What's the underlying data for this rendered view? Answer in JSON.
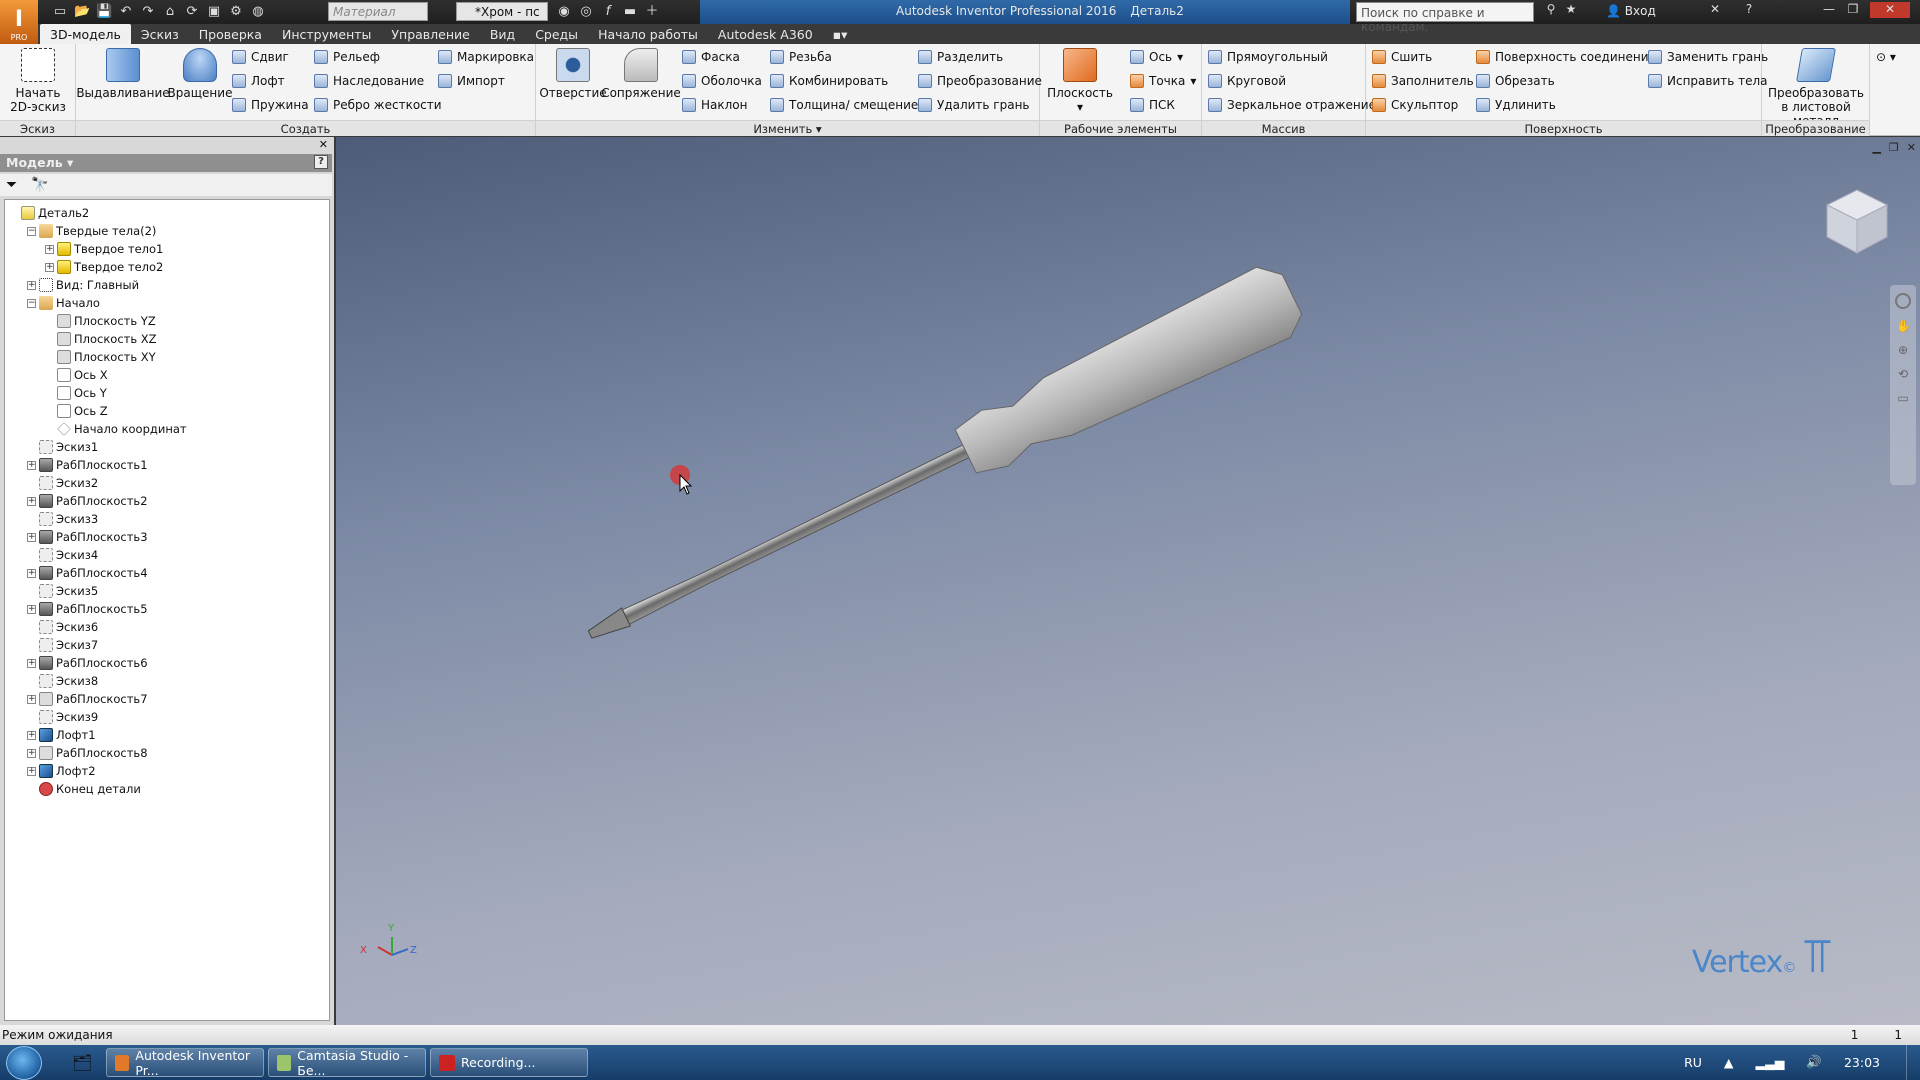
{
  "titlebar": {
    "app_badge": "PRO",
    "material_placeholder": "Материал",
    "appearance_value": "*Хром - пс",
    "window_title": "Autodesk Inventor Professional 2016",
    "document_name": "Деталь2",
    "search_placeholder": "Поиск по справке и командам.",
    "login_label": "Вход"
  },
  "tabs": [
    "3D-модель",
    "Эскиз",
    "Проверка",
    "Инструменты",
    "Управление",
    "Вид",
    "Среды",
    "Начало работы",
    "Autodesk A360"
  ],
  "active_tab": "3D-модель",
  "ribbon": {
    "sketch_panel": {
      "label": "Эскиз",
      "start_sketch": "Начать\n2D-эскиз"
    },
    "create_panel": {
      "label": "Создать",
      "extrude": "Выдавливание",
      "revolve": "Вращение",
      "sweep": "Сдвиг",
      "loft": "Лофт",
      "coil": "Пружина",
      "emboss": "Рельеф",
      "derive": "Наследование",
      "rib": "Ребро жесткости",
      "mark": "Маркировка",
      "import": "Импорт"
    },
    "modify_panel": {
      "label": "Изменить",
      "hole": "Отверстие",
      "fillet": "Сопряжение",
      "chamfer": "Фаска",
      "shell": "Оболочка",
      "draft": "Наклон",
      "thread": "Резьба",
      "combine": "Комбинировать",
      "thicken": "Толщина/ смещение",
      "split": "Разделить",
      "transform": "Преобразование",
      "delete_face": "Удалить грань"
    },
    "work_features_panel": {
      "label": "Рабочие элементы",
      "plane": "Плоскость",
      "axis": "Ось",
      "point": "Точка",
      "ucs": "ПСК"
    },
    "pattern_panel": {
      "label": "Массив",
      "rectangular": "Прямоугольный",
      "circular": "Круговой",
      "mirror": "Зеркальное отражение"
    },
    "surface_panel": {
      "label": "Поверхность",
      "stitch": "Сшить",
      "patch": "Заполнитель",
      "sculpt": "Скульптор",
      "boundary_patch": "Поверхность соединения",
      "trim": "Обрезать",
      "extend": "Удлинить",
      "replace_face": "Заменить грань",
      "repair_bodies": "Исправить тела"
    },
    "convert_panel": {
      "label": "Преобразование",
      "convert_sheet_metal": "Преобразовать в листовой металл"
    }
  },
  "browser": {
    "title": "Модель",
    "tree": [
      {
        "label": "Деталь2",
        "icon": "part",
        "level": 0,
        "expander": ""
      },
      {
        "label": "Твердые тела(2)",
        "icon": "folder",
        "level": 1,
        "expander": "−"
      },
      {
        "label": "Твердое тело1",
        "icon": "body",
        "level": 2,
        "expander": "+"
      },
      {
        "label": "Твердое тело2",
        "icon": "body",
        "level": 2,
        "expander": "+"
      },
      {
        "label": "Вид: Главный",
        "icon": "view",
        "level": 1,
        "expander": "+"
      },
      {
        "label": "Начало",
        "icon": "folder",
        "level": 1,
        "expander": "−"
      },
      {
        "label": "Плоскость YZ",
        "icon": "plane",
        "level": 2,
        "expander": ""
      },
      {
        "label": "Плоскость XZ",
        "icon": "plane",
        "level": 2,
        "expander": ""
      },
      {
        "label": "Плоскость XY",
        "icon": "plane",
        "level": 2,
        "expander": ""
      },
      {
        "label": "Ось X",
        "icon": "axis",
        "level": 2,
        "expander": ""
      },
      {
        "label": "Ось Y",
        "icon": "axis",
        "level": 2,
        "expander": ""
      },
      {
        "label": "Ось Z",
        "icon": "axis",
        "level": 2,
        "expander": ""
      },
      {
        "label": "Начало координат",
        "icon": "point",
        "level": 2,
        "expander": ""
      },
      {
        "label": "Эскиз1",
        "icon": "sketch",
        "level": 1,
        "expander": ""
      },
      {
        "label": "РабПлоскость1",
        "icon": "wplane",
        "level": 1,
        "expander": "+"
      },
      {
        "label": "Эскиз2",
        "icon": "sketch",
        "level": 1,
        "expander": ""
      },
      {
        "label": "РабПлоскость2",
        "icon": "wplane",
        "level": 1,
        "expander": "+"
      },
      {
        "label": "Эскиз3",
        "icon": "sketch",
        "level": 1,
        "expander": ""
      },
      {
        "label": "РабПлоскость3",
        "icon": "wplane",
        "level": 1,
        "expander": "+"
      },
      {
        "label": "Эскиз4",
        "icon": "sketch",
        "level": 1,
        "expander": ""
      },
      {
        "label": "РабПлоскость4",
        "icon": "wplane",
        "level": 1,
        "expander": "+"
      },
      {
        "label": "Эскиз5",
        "icon": "sketch",
        "level": 1,
        "expander": ""
      },
      {
        "label": "РабПлоскость5",
        "icon": "wplane",
        "level": 1,
        "expander": "+"
      },
      {
        "label": "Эскиз6",
        "icon": "sketch",
        "level": 1,
        "expander": ""
      },
      {
        "label": "Эскиз7",
        "icon": "sketch",
        "level": 1,
        "expander": ""
      },
      {
        "label": "РабПлоскость6",
        "icon": "wplane",
        "level": 1,
        "expander": "+"
      },
      {
        "label": "Эскиз8",
        "icon": "sketch",
        "level": 1,
        "expander": ""
      },
      {
        "label": "РабПлоскость7",
        "icon": "plane",
        "level": 1,
        "expander": "+"
      },
      {
        "label": "Эскиз9",
        "icon": "sketch",
        "level": 1,
        "expander": ""
      },
      {
        "label": "Лофт1",
        "icon": "loft",
        "level": 1,
        "expander": "+"
      },
      {
        "label": "РабПлоскость8",
        "icon": "plane",
        "level": 1,
        "expander": "+"
      },
      {
        "label": "Лофт2",
        "icon": "loft",
        "level": 1,
        "expander": "+"
      },
      {
        "label": "Конец детали",
        "icon": "end",
        "level": 1,
        "expander": ""
      }
    ]
  },
  "viewport": {
    "watermark": "Vertex",
    "triad_labels": [
      "X",
      "Y",
      "Z"
    ]
  },
  "statusbar": {
    "text": "Режим ожидания",
    "count1": "1",
    "count2": "1"
  },
  "taskbar": {
    "items": [
      "Autodesk Inventor Pr...",
      "Camtasia Studio - Бе...",
      "Recording..."
    ],
    "language": "RU",
    "clock": "23:03"
  }
}
